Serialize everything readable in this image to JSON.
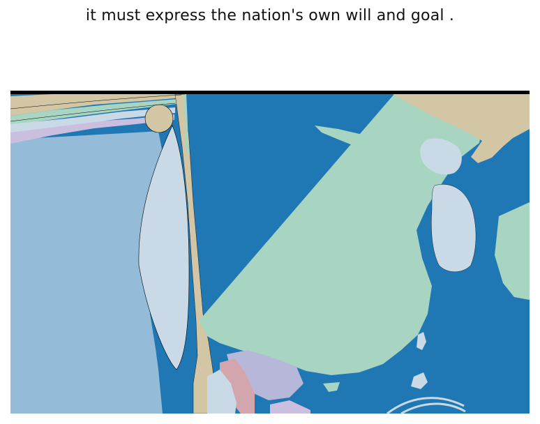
{
  "caption": "it must express the nation's own will and goal .",
  "map": {
    "colors": {
      "ocean": "#1f77b4",
      "mint": "#a8d5c2",
      "tan": "#d2c6a5",
      "pale_blue": "#c9dae6",
      "sky": "#94bbd8",
      "lavender": "#b7b7d9",
      "rose": "#d3a6ae",
      "lilac": "#cbbfe0",
      "border_line": "#000000"
    }
  }
}
